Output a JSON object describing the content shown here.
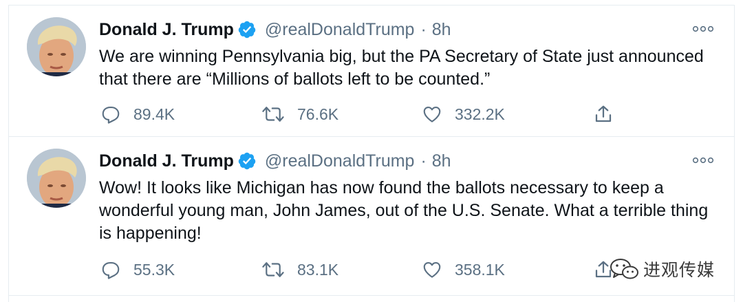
{
  "tweets": [
    {
      "author": {
        "name": "Donald J. Trump",
        "handle": "@realDonaldTrump",
        "verified": true,
        "avatar_icon": "profile-photo"
      },
      "separator": "·",
      "time": "8h",
      "text": "We are winning Pennsylvania big, but the PA Secretary of State just announced that there are “Millions of ballots left to be counted.”",
      "stats": {
        "replies": "89.4K",
        "retweets": "76.6K",
        "likes": "332.2K"
      }
    },
    {
      "author": {
        "name": "Donald J. Trump",
        "handle": "@realDonaldTrump",
        "verified": true,
        "avatar_icon": "profile-photo"
      },
      "separator": "·",
      "time": "8h",
      "text": "Wow! It looks like Michigan has now found the ballots necessary to keep a wonderful young man, John James, out of the U.S. Senate. What a terrible thing is happening!",
      "stats": {
        "replies": "55.3K",
        "retweets": "83.1K",
        "likes": "358.1K"
      }
    }
  ],
  "watermark": {
    "icon": "wechat-icon",
    "text": "进观传媒"
  },
  "colors": {
    "verified_badge": "#1da1f2",
    "secondary_text": "#5b7083",
    "primary_text": "#0f1419",
    "divider": "#e6ecf0"
  }
}
